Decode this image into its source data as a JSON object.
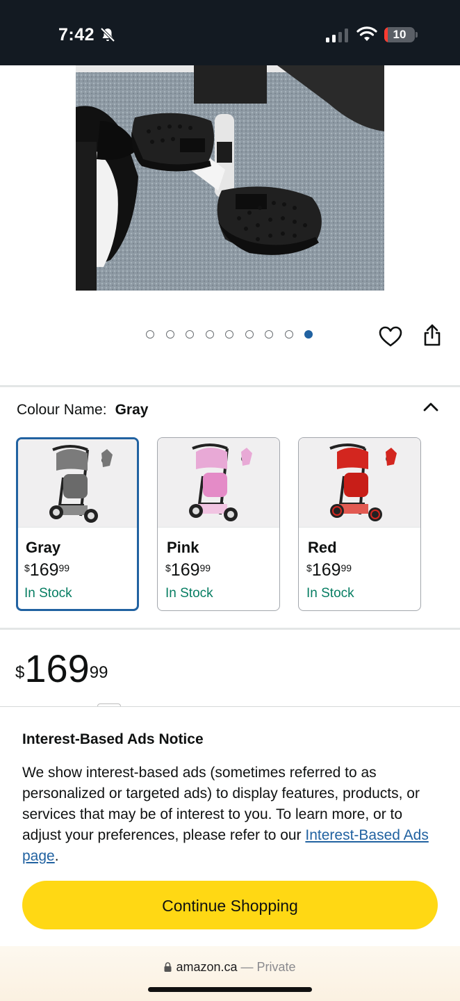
{
  "status_bar": {
    "time": "7:42",
    "battery_level": "10",
    "icons": [
      "bell-slash-icon",
      "cellular-signal-icon",
      "wifi-icon",
      "battery-icon"
    ]
  },
  "product": {
    "image_alt": "Tricycle footrest close-up",
    "carousel": {
      "total": 9,
      "active_index": 8
    }
  },
  "colour": {
    "label": "Colour Name:",
    "selected": "Gray",
    "options": [
      {
        "name": "Gray",
        "price_dollars": "169",
        "price_cents": "99",
        "stock": "In Stock",
        "color": "#6f6f6f"
      },
      {
        "name": "Pink",
        "price_dollars": "169",
        "price_cents": "99",
        "stock": "In Stock",
        "color": "#e8a9d6"
      },
      {
        "name": "Red",
        "price_dollars": "169",
        "price_cents": "99",
        "stock": "In Stock",
        "color": "#d3261f"
      }
    ]
  },
  "price": {
    "currency": "$",
    "dollars": "169",
    "cents": "99"
  },
  "ads_notice": {
    "title": "Interest-Based Ads Notice",
    "body": "We show interest-based ads (sometimes referred to as personalized or targeted ads) to display features, products, or services that may be of interest to you. To learn more, or to adjust your preferences, please refer to our ",
    "link_text": "Interest-Based Ads page",
    "body_end": ".",
    "button_label": "Continue Shopping"
  },
  "browser": {
    "domain": "amazon.ca",
    "separator": "—",
    "mode": "Private"
  },
  "colors": {
    "accent_blue": "#2162a1",
    "button_yellow": "#ffd814",
    "stock_green": "#067d62",
    "status_bar_bg": "#131a22"
  }
}
